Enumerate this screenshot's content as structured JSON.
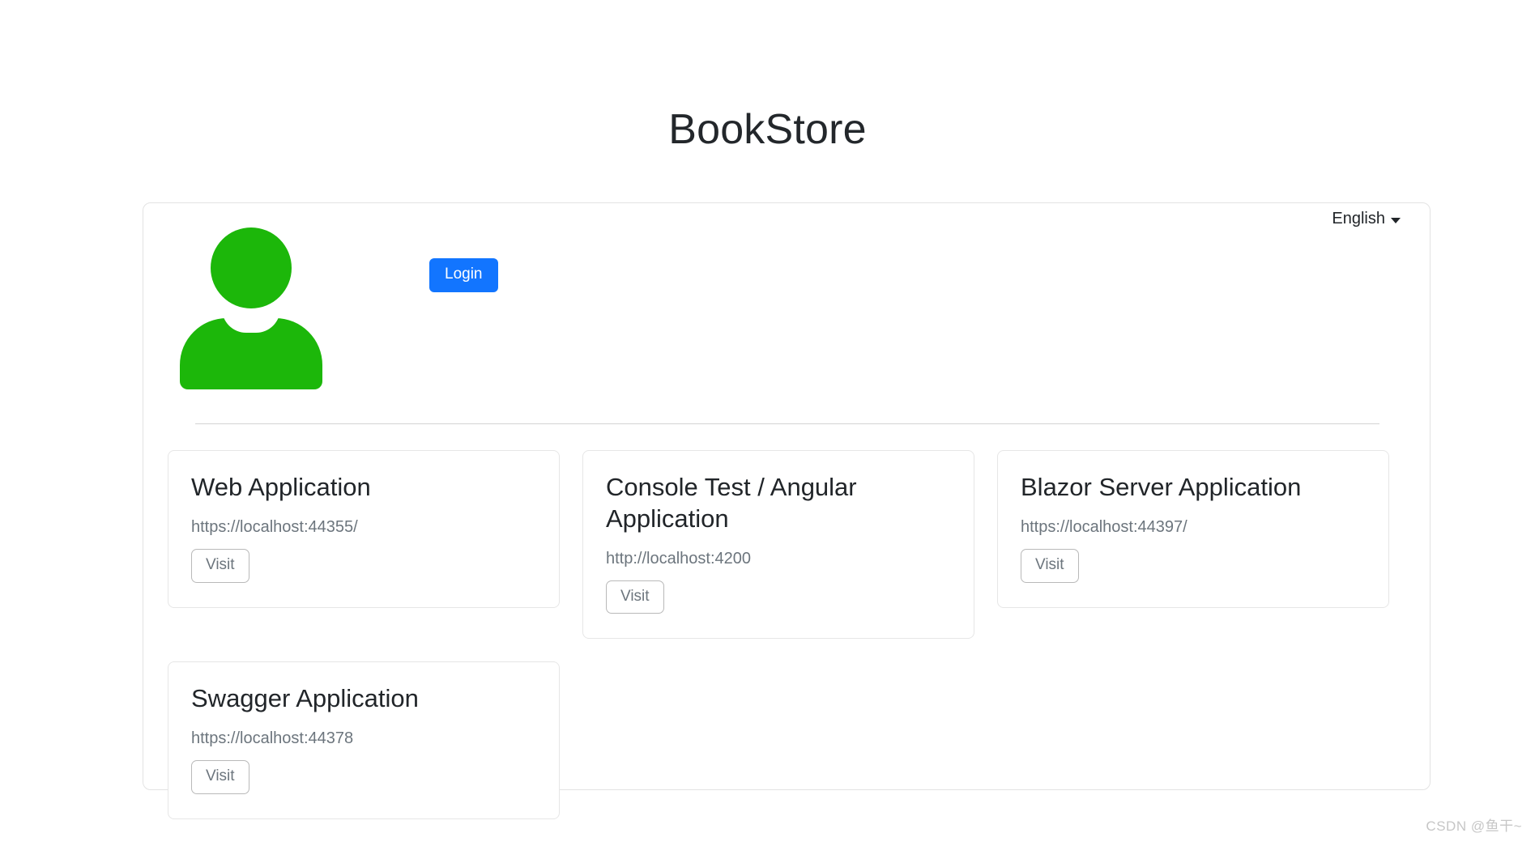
{
  "header": {
    "title": "BookStore"
  },
  "account": {
    "avatar_icon": "user-avatar-icon",
    "login_label": "Login"
  },
  "language": {
    "selected": "English",
    "caret_icon": "chevron-down-icon"
  },
  "applications": {
    "visit_label": "Visit",
    "cards": [
      {
        "title": "Web Application",
        "url": "https://localhost:44355/",
        "button": "Visit"
      },
      {
        "title": "Console Test / Angular Application",
        "url": "http://localhost:4200",
        "button": "Visit"
      },
      {
        "title": "Blazor Server Application",
        "url": "https://localhost:44397/",
        "button": "Visit"
      },
      {
        "title": "Swagger Application",
        "url": "https://localhost:44378",
        "button": "Visit"
      }
    ]
  },
  "watermark": {
    "text": "CSDN @鱼干~"
  },
  "colors": {
    "avatar_green": "#1cb70a",
    "login_blue": "#1275ff",
    "title_dark": "#23272b",
    "muted_gray": "#6c757d",
    "border_gray": "#e6e6e6"
  }
}
